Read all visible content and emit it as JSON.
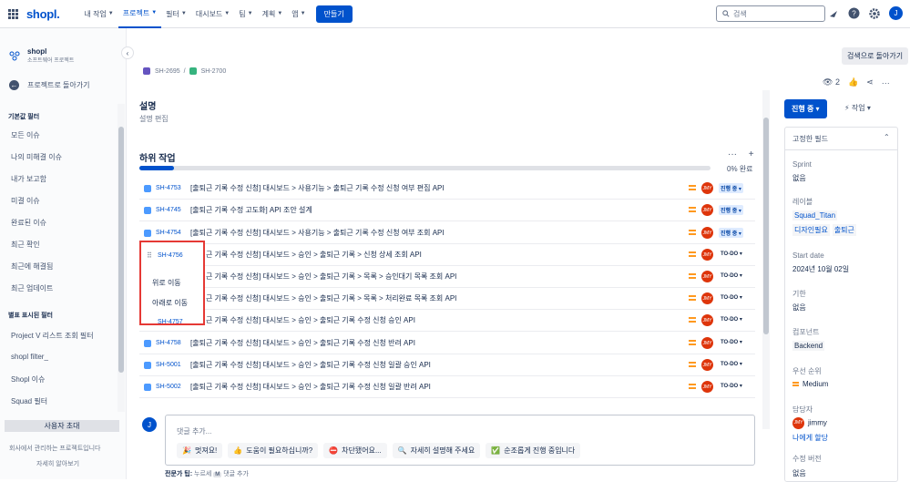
{
  "topbar": {
    "logo": "shopl.",
    "nav": [
      {
        "label": "내 작업",
        "active": false
      },
      {
        "label": "프로젝트",
        "active": true
      },
      {
        "label": "필터",
        "active": false
      },
      {
        "label": "대시보드",
        "active": false
      },
      {
        "label": "팀",
        "active": false
      },
      {
        "label": "계획",
        "active": false
      },
      {
        "label": "앱",
        "active": false
      }
    ],
    "create": "만들기",
    "search_placeholder": "검색",
    "user_initial": "J"
  },
  "sidebar": {
    "project_name": "shopl",
    "project_type": "소프트웨어 프로젝트",
    "back": "프로젝트로 돌아가기",
    "default_filters_title": "기본값 필터",
    "default_filters": [
      "모든 이슈",
      "나의 미해결 이슈",
      "내가 보고함",
      "미결 이슈",
      "완료된 이슈",
      "최근 확인",
      "최근에 해결됨",
      "최근 업데이트"
    ],
    "starred_title": "별표 표시된 필터",
    "starred": [
      "Project V 리스트 조회 필터",
      "shopl filter_",
      "Shopl 이슈",
      "Squad 필터"
    ],
    "invite": "사용자 초대",
    "footer_line1": "회사에서 관리하는 프로젝트입니다",
    "footer_line2": "자세히 알아보기"
  },
  "main": {
    "breadcrumb": [
      "SH-2695",
      "/",
      "SH-2700"
    ],
    "description_title": "설명",
    "description_edit": "설명 편집",
    "subtasks_title": "하위 작업",
    "subtasks_more": "···",
    "subtasks_add": "+",
    "progress_label": "0% 완료",
    "progress_fraction": 0.06,
    "rows": [
      {
        "key": "SH-4753",
        "summary": "[출퇴근 기록 수정 신청] 대시보드 > 사용기능 > 출퇴근 기록 수정 신청 여부 편집 API",
        "status": "진행 중",
        "avatar": "JMY"
      },
      {
        "key": "SH-4745",
        "summary": "[출퇴근 기록 수정 고도화] API 조안 설계",
        "status": "진행 중",
        "avatar": "JMY"
      },
      {
        "key": "SH-4754",
        "summary": "[출퇴근 기록 수정 신청] 대시보드 > 사용기능 > 출퇴근 기록 수정 신청 여부 조회 API",
        "status": "진행 중",
        "avatar": "JMY"
      },
      {
        "key": "SH-4756",
        "summary": "[출퇴근 기록 수정 신청] 대시보드 > 승인 > 출퇴근 기록 > 신청 상세 조회 API",
        "status": "TO-DO",
        "avatar": "JMY"
      },
      {
        "key": "",
        "summary": "[출퇴근 기록 수정 신청] 대시보드 > 승인 > 출퇴근 기록 > 목록 > 승인대기 목록 조회 API",
        "status": "TO-DO",
        "avatar": "JMY"
      },
      {
        "key": "",
        "summary": "[출퇴근 기록 수정 신청] 대시보드 > 승인 > 출퇴근 기록 > 목록 > 처리완료 목록 조회 API",
        "status": "TO-DO",
        "avatar": "JMY"
      },
      {
        "key": "SH-4757",
        "summary": "[출퇴근 기록 수정 신청] 대시보드 > 승인 > 출퇴근 기록 수정 신청 승인 API",
        "status": "TO-DO",
        "avatar": "JMY"
      },
      {
        "key": "SH-4758",
        "summary": "[출퇴근 기록 수정 신청] 대시보드 > 승인 > 출퇴근 기록 수정 신청 반려 API",
        "status": "TO-DO",
        "avatar": "JMY"
      },
      {
        "key": "SH-5001",
        "summary": "[출퇴근 기록 수정 신청] 대시보드 > 승인 > 출퇴근 기록 수정 신청 일괄 승인 API",
        "status": "TO-DO",
        "avatar": "JMY"
      },
      {
        "key": "SH-5002",
        "summary": "[출퇴근 기록 수정 신청] 대시보드 > 승인 > 출퇴근 기록 수정 신청 일괄 반려 API",
        "status": "TO-DO",
        "avatar": "JMY"
      }
    ],
    "context_menu": {
      "key": "SH-4756",
      "move_up": "위로 이동",
      "move_down": "아래로 이동",
      "key_below": "SH-4757"
    },
    "comment": {
      "avatar": "J",
      "placeholder": "댓글 추가...",
      "chips": [
        {
          "emoji": "🎉",
          "label": "멋져요!"
        },
        {
          "emoji": "👍",
          "label": "도움이 필요하십니까?"
        },
        {
          "emoji": "⛔",
          "label": "차단됐어요..."
        },
        {
          "emoji": "🔍",
          "label": "자세히 설명해 주세요"
        },
        {
          "emoji": "✅",
          "label": "순조롭게 진행 중입니다"
        }
      ],
      "tip_prefix": "전문가 팁:",
      "tip_mid": "누르세",
      "tip_key": "M",
      "tip_suffix": "댓글 추가"
    }
  },
  "right": {
    "back_to_search": "검색으로 돌아가기",
    "watch_count": "2",
    "status": "진행 중",
    "action": "작업",
    "pinned_title": "고정한 필드",
    "fields": [
      {
        "label": "Sprint",
        "value": "없음"
      },
      {
        "label": "레이블",
        "tags": [
          "Squad_Titan",
          "디자인필요",
          "출퇴근"
        ]
      },
      {
        "label": "Start date",
        "value": "2024년 10월 02일"
      },
      {
        "label": "기한",
        "value": "없음"
      },
      {
        "label": "컴포넌트",
        "tags": [
          "Backend"
        ]
      },
      {
        "label": "우선 순위",
        "value": "Medium"
      },
      {
        "label": "담당자",
        "value": "jimmy",
        "avatar": "JMY",
        "link": "나에게 할당"
      },
      {
        "label": "수정 버전",
        "value": "없음"
      }
    ]
  }
}
